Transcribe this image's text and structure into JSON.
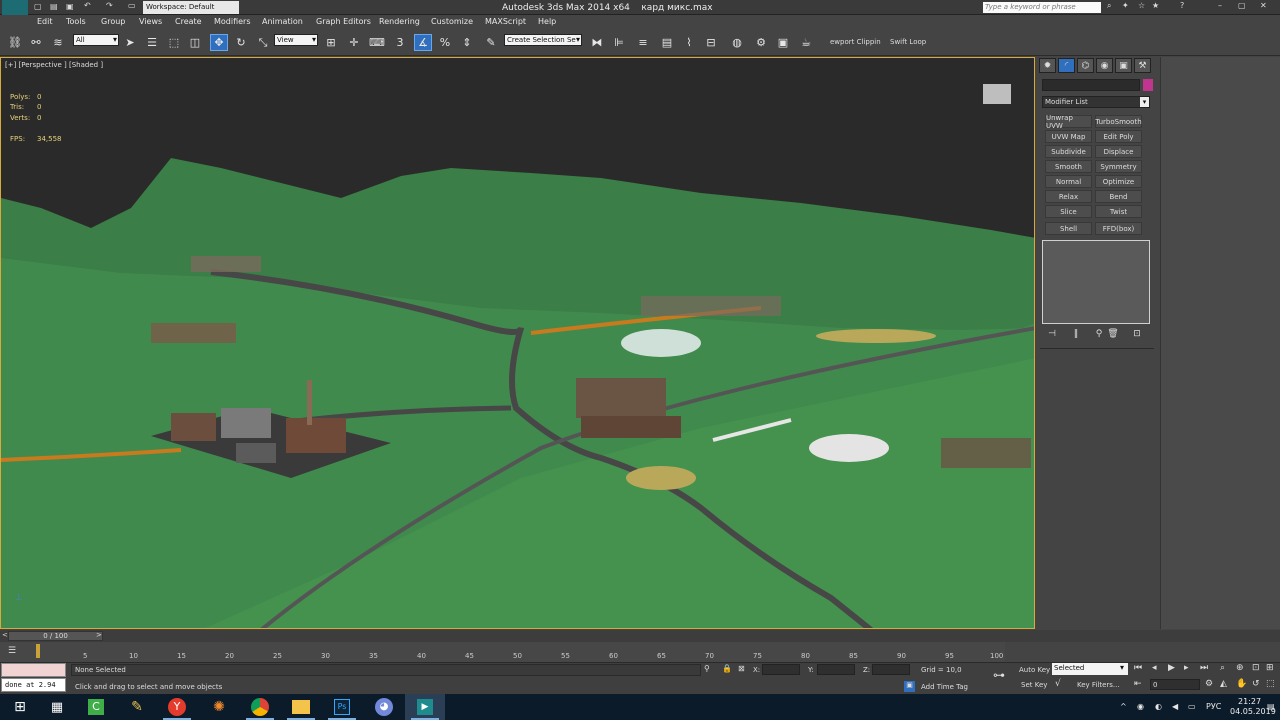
{
  "app": {
    "title": "Autodesk 3ds Max  2014 x64",
    "file": "кард микс.max",
    "workspace": "Workspace: Default",
    "search_placeholder": "Type a keyword or phrase"
  },
  "menu": [
    "Edit",
    "Tools",
    "Group",
    "Views",
    "Create",
    "Modifiers",
    "Animation",
    "Graph Editors",
    "Rendering",
    "Customize",
    "MAXScript",
    "Help"
  ],
  "toolbar": {
    "filter": "All",
    "refcoord": "View",
    "selection_set": "Create Selection Se",
    "viewport_clipping": "ewport Clippin",
    "swift_loop": "Swift Loop"
  },
  "viewport": {
    "label": "[+] [Perspective ] [Shaded ]",
    "stats": [
      {
        "label": "Polys:",
        "value": "0"
      },
      {
        "label": "Tris:",
        "value": "0"
      },
      {
        "label": "Verts:",
        "value": "0"
      }
    ],
    "fps_label": "FPS:",
    "fps_value": "34,558",
    "colors": {
      "sky": "#2a2a2a",
      "terrain": "#3f8a4c",
      "road": "#444444",
      "highlight": "#d9a93a"
    }
  },
  "command_panel": {
    "modifier_list": "Modifier List",
    "color_swatch": "#c0368e",
    "buttons": [
      "Unwrap UVW",
      "TurboSmooth",
      "UVW Map",
      "Edit Poly",
      "Subdivide",
      "Displace",
      "Smooth",
      "Symmetry",
      "Normal",
      "Optimize",
      "Relax",
      "Bend",
      "Slice",
      "Twist",
      "Shell",
      "FFD(box)"
    ]
  },
  "timeline": {
    "slider": "0 / 100",
    "ticks": [
      "5",
      "10",
      "15",
      "20",
      "25",
      "30",
      "35",
      "40",
      "45",
      "50",
      "55",
      "60",
      "65",
      "70",
      "75",
      "80",
      "85",
      "90",
      "95",
      "100"
    ]
  },
  "status": {
    "maxscript": "done at 2.94",
    "selection": "None Selected",
    "prompt": "Click and drag to select and move objects",
    "x_label": "X:",
    "y_label": "Y:",
    "z_label": "Z:",
    "grid": "Grid = 10,0",
    "add_time_tag": "Add Time Tag",
    "auto_key": "Auto Key",
    "set_key": "Set Key",
    "selected": "Selected",
    "key_filters": "Key Filters...",
    "frame": "0"
  },
  "taskbar": {
    "lang": "РУС",
    "time": "21:27",
    "date": "04.05.2019"
  }
}
